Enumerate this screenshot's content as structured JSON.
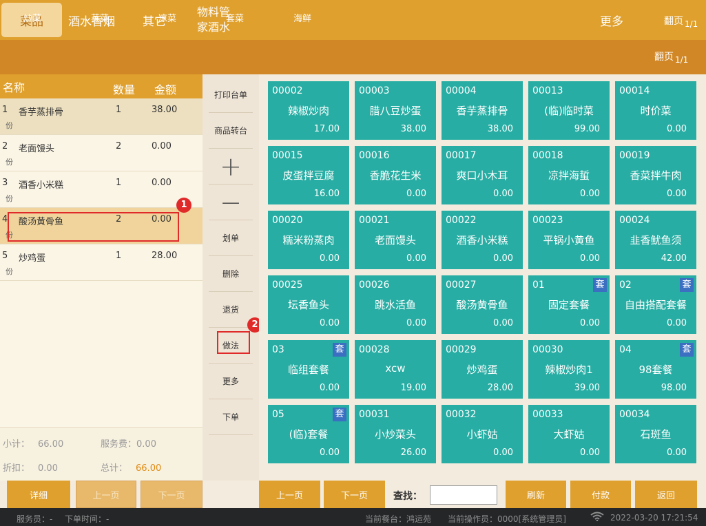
{
  "top_tabs": [
    {
      "label": "菜品"
    },
    {
      "label": "酒水香烟"
    },
    {
      "label": "其它"
    },
    {
      "label": "物料管家酒水"
    }
  ],
  "top_more": "更多",
  "page_turn": "翻页",
  "page_num": "1/1",
  "sub_tabs": [
    "炒菜",
    "蒸菜",
    "凉菜",
    "套菜",
    "海鲜"
  ],
  "order": {
    "header": {
      "name": "名称",
      "qty": "数量",
      "amount": "金额"
    },
    "rows": [
      {
        "idx": "1",
        "name": "香芋蒸排骨",
        "qty": "1",
        "amount": "38.00",
        "unit": "份"
      },
      {
        "idx": "2",
        "name": "老面馒头",
        "qty": "2",
        "amount": "0.00",
        "unit": "份"
      },
      {
        "idx": "3",
        "name": "酒香小米糕",
        "qty": "1",
        "amount": "0.00",
        "unit": "份"
      },
      {
        "idx": "4",
        "name": "酸汤黄骨鱼",
        "qty": "2",
        "amount": "0.00",
        "unit": "份"
      },
      {
        "idx": "5",
        "name": "炒鸡蛋",
        "qty": "1",
        "amount": "28.00",
        "unit": "份"
      }
    ],
    "subtotal_label": "小计：",
    "subtotal": "66.00",
    "service_label": "服务费：",
    "service": "0.00",
    "discount_label": "折扣：",
    "discount": "0.00",
    "total_label": "总计：",
    "total": "66.00"
  },
  "callouts": [
    "1",
    "2"
  ],
  "actions": {
    "print": "打印台单",
    "transfer": "商品转台",
    "plus": "+",
    "minus": "−",
    "mark": "划单",
    "delete": "删除",
    "return": "退货",
    "method": "做法",
    "more": "更多",
    "submit": "下单"
  },
  "set_badge": "套",
  "dishes": [
    {
      "code": "00002",
      "name": "辣椒炒肉",
      "price": "17.00"
    },
    {
      "code": "00003",
      "name": "腊八豆炒蛋",
      "price": "38.00"
    },
    {
      "code": "00004",
      "name": "香芋蒸排骨",
      "price": "38.00"
    },
    {
      "code": "00013",
      "name": "(临)临时菜",
      "price": "99.00"
    },
    {
      "code": "00014",
      "name": "时价菜",
      "price": "0.00"
    },
    {
      "code": "00015",
      "name": "皮蛋拌豆腐",
      "price": "16.00"
    },
    {
      "code": "00016",
      "name": "香脆花生米",
      "price": "0.00"
    },
    {
      "code": "00017",
      "name": "爽口小木耳",
      "price": "0.00"
    },
    {
      "code": "00018",
      "name": "凉拌海蜇",
      "price": "0.00"
    },
    {
      "code": "00019",
      "name": "香菜拌牛肉",
      "price": "0.00"
    },
    {
      "code": "00020",
      "name": "糯米粉蒸肉",
      "price": "0.00"
    },
    {
      "code": "00021",
      "name": "老面馒头",
      "price": "0.00"
    },
    {
      "code": "00022",
      "name": "酒香小米糕",
      "price": "0.00"
    },
    {
      "code": "00023",
      "name": "平锅小黄鱼",
      "price": "0.00"
    },
    {
      "code": "00024",
      "name": "韭香鱿鱼须",
      "price": "42.00"
    },
    {
      "code": "00025",
      "name": "坛香鱼头",
      "price": "0.00"
    },
    {
      "code": "00026",
      "name": "跳水活鱼",
      "price": "0.00"
    },
    {
      "code": "00027",
      "name": "酸汤黄骨鱼",
      "price": "0.00"
    },
    {
      "code": "01",
      "name": "固定套餐",
      "price": "0.00",
      "set": true
    },
    {
      "code": "02",
      "name": "自由搭配套餐",
      "price": "0.00",
      "set": true
    },
    {
      "code": "03",
      "name": "临组套餐",
      "price": "0.00",
      "set": true
    },
    {
      "code": "00028",
      "name": "xcw",
      "price": "19.00"
    },
    {
      "code": "00029",
      "name": "炒鸡蛋",
      "price": "28.00"
    },
    {
      "code": "00030",
      "name": "辣椒炒肉1",
      "price": "39.00"
    },
    {
      "code": "04",
      "name": "98套餐",
      "price": "98.00",
      "set": true
    },
    {
      "code": "05",
      "name": "(临)套餐",
      "price": "0.00",
      "set": true
    },
    {
      "code": "00031",
      "name": "小炒菜头",
      "price": "26.00"
    },
    {
      "code": "00032",
      "name": "小虾姑",
      "price": "0.00"
    },
    {
      "code": "00033",
      "name": "大虾姑",
      "price": "0.00"
    },
    {
      "code": "00034",
      "name": "石斑鱼",
      "price": "0.00"
    }
  ],
  "bottom": {
    "detail": "详细",
    "prev": "上一页",
    "next": "下一页",
    "grid_prev": "上一页",
    "grid_next": "下一页",
    "search_label": "查找：",
    "search_value": "",
    "refresh": "刷新",
    "pay": "付款",
    "back": "返回"
  },
  "status": {
    "waiter": "服务员：-",
    "order_time": "下单时间：-",
    "restaurant": "当前餐台：鸿运苑",
    "operator": "当前操作员：0000[系统管理员]",
    "datetime": "2022-03-20 17:21:54"
  },
  "colors": {
    "accent": "#dfa02e",
    "tile": "#27ada3",
    "highlight": "#e02a2a",
    "set_badge": "#3b6fc2"
  },
  "icons": [
    "wifi-icon",
    "plus-icon",
    "minus-icon"
  ]
}
